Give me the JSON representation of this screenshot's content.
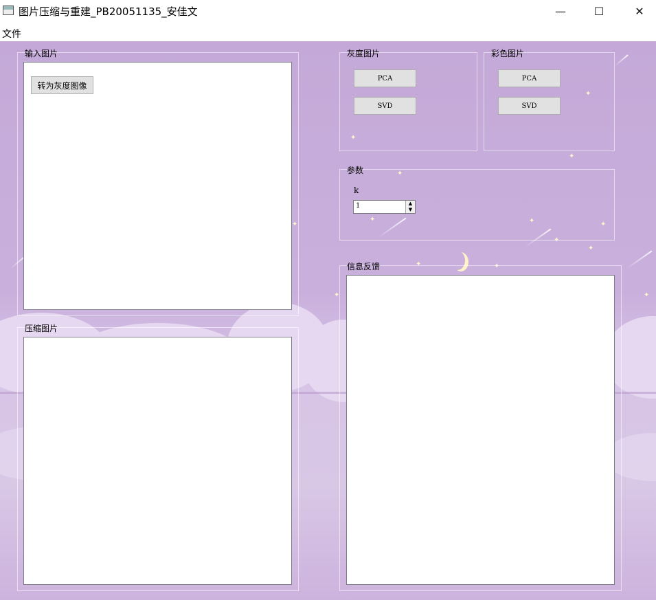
{
  "window": {
    "title": "图片压缩与重建_PB20051135_安佳文",
    "controls": {
      "minimize": "—",
      "maximize": "☐",
      "close": "✕"
    }
  },
  "menu": {
    "items": [
      {
        "label": "文件"
      }
    ]
  },
  "input_group": {
    "title": "输入图片",
    "gray_button": "转为灰度图像"
  },
  "compressed_group": {
    "title": "压缩图片"
  },
  "gray_group": {
    "title": "灰度图片",
    "pca_button": "PCA",
    "svd_button": "SVD"
  },
  "color_group": {
    "title": "彩色图片",
    "pca_button": "PCA",
    "svd_button": "SVD"
  },
  "params_group": {
    "title": "参数",
    "k_label": "k",
    "k_value": "1"
  },
  "feedback_group": {
    "title": "信息反馈"
  },
  "colors": {
    "background": "#c4a9d8",
    "panel": "#ffffff",
    "button": "#e1e1e1"
  }
}
